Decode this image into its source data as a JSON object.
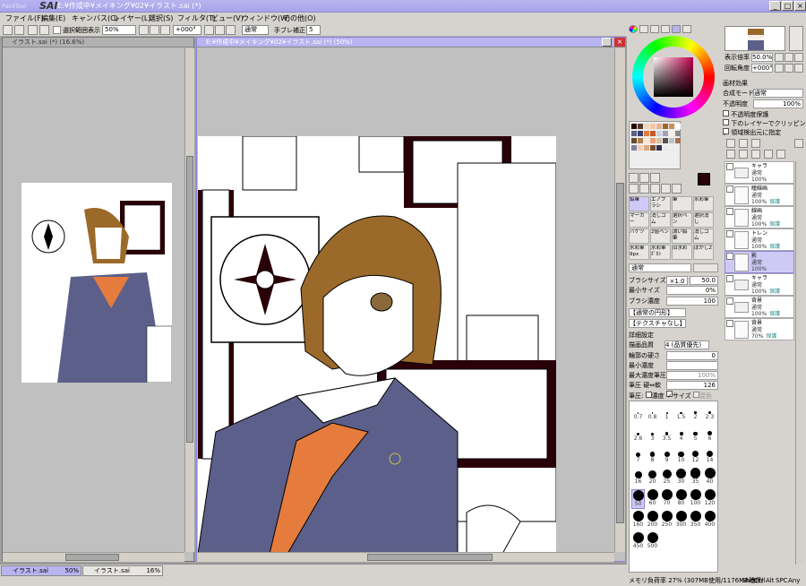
{
  "titlebar": {
    "logo_small": "PaintTool",
    "logo": "SAI",
    "title": "E:¥作成中¥メイキング¥02¥イラスト.sai (*)",
    "btn_min": "_",
    "btn_max": "□",
    "btn_close": "×"
  },
  "menu": [
    "ファイル(F)",
    "編集(E)",
    "キャンバス(C)",
    "レイヤー(L)",
    "選択(S)",
    "フィルタ(T)",
    "ビュー(V)",
    "ウィンドウ(W)",
    "その他(O)"
  ],
  "toolbar": {
    "selection_label": "選択範囲表示",
    "zoom": "50%",
    "rotation": "+000°",
    "mode": "通常",
    "stabilizer_label": "手ブレ補正",
    "stabilizer": "5"
  },
  "left_window": {
    "title": "イラスト.sai (*) (16.6%)"
  },
  "main_window": {
    "title": "E:¥作成中¥メイキング¥02¥イラスト.sai (*) (50%)"
  },
  "tasks": [
    {
      "label": "イラスト.sai",
      "zoom": "50%"
    },
    {
      "label": "イラスト.sai",
      "zoom": "16%"
    }
  ],
  "status": {
    "memory": "メモリ負荷率 27% (307MB使用/1176MB確保)",
    "keys": [
      "Shift",
      "Ctrl",
      "Alt",
      "SPC",
      "Any"
    ]
  },
  "navigator": {
    "zoom_label": "表示倍率",
    "zoom_value": "50.0%",
    "rotation_label": "回転角度",
    "rotation_value": "+000°"
  },
  "layer_props": {
    "effect_label": "画材効果",
    "blend_label": "合成モード",
    "blend_value": "通常",
    "opacity_label": "不透明度",
    "opacity_value": "100%",
    "protect_opacity": "不透明度保護",
    "clip_label": "下のレイヤーでクリッピング",
    "selection_source": "領域検出元に指定"
  },
  "layers": [
    {
      "name": "キャラ",
      "mode": "通常",
      "opacity": "100%",
      "folder": true,
      "selected": false
    },
    {
      "name": "瞳線画",
      "mode": "通常",
      "opacity": "100%",
      "extra": "保護",
      "selected": false
    },
    {
      "name": "線画",
      "mode": "通常",
      "opacity": "100%",
      "extra": "保護",
      "selected": false
    },
    {
      "name": "トレン",
      "mode": "通常",
      "opacity": "100%",
      "extra": "保護",
      "selected": false
    },
    {
      "name": "影",
      "mode": "通常",
      "opacity": "100%",
      "selected": true
    },
    {
      "name": "キャラ",
      "mode": "通常",
      "opacity": "100%",
      "extra": "保護",
      "folder": true,
      "selected": false
    },
    {
      "name": "背景",
      "mode": "通常",
      "opacity": "100%",
      "extra": "保護",
      "folder": true,
      "selected": false
    },
    {
      "name": "背景",
      "mode": "通常",
      "opacity": "70%",
      "extra": "保護",
      "selected": false
    }
  ],
  "tools": [
    {
      "label": "鉛筆",
      "sub": ""
    },
    {
      "label": "エアブラシ",
      "sub": ""
    },
    {
      "label": "筆",
      "sub": ""
    },
    {
      "label": "水彩筆",
      "sub": ""
    },
    {
      "label": "マーカー",
      "sub": ""
    },
    {
      "label": "消しゴム",
      "sub": ""
    },
    {
      "label": "選択ペン",
      "sub": ""
    },
    {
      "label": "選択消し",
      "sub": ""
    },
    {
      "label": "バケツ",
      "sub": ""
    },
    {
      "label": "2値ペン",
      "sub": ""
    },
    {
      "label": "濃い鉛筆",
      "sub": ""
    },
    {
      "label": "消しゴム",
      "sub": ""
    },
    {
      "label": "水彩筆",
      "sub": "9px"
    },
    {
      "label": "水彩筆",
      "sub": "ﾎﾞｶｼ"
    },
    {
      "label": "旧水彩",
      "sub": ""
    },
    {
      "label": "ぼかし2",
      "sub": ""
    }
  ],
  "brush_settings": {
    "mode": "通常",
    "size_label": "ブラシサイズ",
    "size_mult": "×1.0",
    "size_value": "50.0",
    "min_size_label": "最小サイズ",
    "min_size_value": "0%",
    "density_label": "ブラシ濃度",
    "density_value": "100",
    "shape_label": "【通常の円形】",
    "texture_label": "【テクスチャなし】",
    "detail_label": "詳細設定",
    "quality_label": "描画品質",
    "quality_value": "4 (品質優先)",
    "edge_label": "輪郭の硬さ",
    "edge_value": "0",
    "min_density_label": "最小濃度",
    "max_density_label": "最大濃度筆圧",
    "max_density_value": "100%",
    "pressure_label": "筆圧 硬⇔軟",
    "pressure_value": "126",
    "pressure_opts_label": "筆圧:",
    "opt_density": "濃度",
    "opt_size": "サイズ",
    "opt_blend": "混色"
  },
  "brush_sizes": [
    "0.7",
    "0.8",
    "1",
    "1.5",
    "2",
    "2.3",
    "2.6",
    "3",
    "3.5",
    "4",
    "5",
    "6",
    "7",
    "8",
    "9",
    "10",
    "12",
    "14",
    "16",
    "20",
    "25",
    "30",
    "35",
    "40",
    "50",
    "60",
    "70",
    "80",
    "100",
    "120",
    "160",
    "200",
    "250",
    "300",
    "350",
    "400",
    "450",
    "500"
  ],
  "colors": {
    "accent": "#b8b4ef",
    "main_color": "#2a0008",
    "sub_color": "#4ab8a0",
    "selected_layer": "#cfcaf5"
  }
}
